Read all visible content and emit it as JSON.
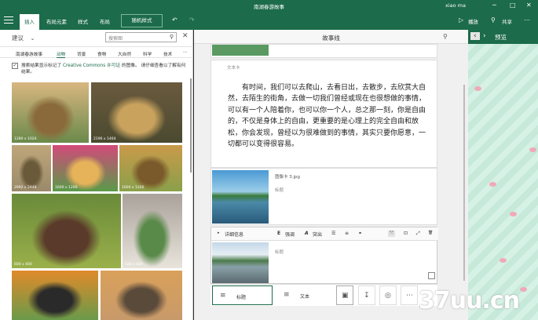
{
  "window": {
    "title": "南湖春游故事",
    "user": "xiao ma",
    "minimize": "─",
    "maximize": "□",
    "close": "✕"
  },
  "ribbon": {
    "tabs": [
      "插入",
      "布局元素",
      "样式",
      "布局"
    ],
    "layout_button": "随机样式",
    "play": "播放",
    "share": "共享",
    "undo_icon": "↶",
    "redo_icon": "↷",
    "play_icon": "▷",
    "share_icon": "⚲",
    "more_icon": "⋯"
  },
  "left_panel": {
    "suggest": "建议",
    "suggest_caret": "⌄",
    "search_placeholder": "搜索图",
    "search_icon": "⚲",
    "close_icon": "✕",
    "categories": [
      "南湖春游故事",
      "动物",
      "背景",
      "食物",
      "大自然",
      "科学",
      "技术",
      "⋯"
    ],
    "cc_check": "✓",
    "cc_notice_pre": "搜索结果显示标记了 ",
    "cc_link": "Creative Commons 许可证",
    "cc_notice_post": " 的图像。 请仔细查看以了解有何结果。",
    "photos": [
      {
        "dim": "1280 x 1024",
        "colors": [
          "#d9b681",
          "#8a6a3a",
          "#6a8a4a"
        ]
      },
      {
        "dim": "2196 x 1464",
        "colors": [
          "#6b5a3e",
          "#c9a35e",
          "#4a4a30"
        ]
      },
      {
        "dim": "2992 x 2448",
        "colors": [
          "#bfa67a",
          "#6a5a3a",
          "#9a8a6a"
        ]
      },
      {
        "dim": "1600 x 1200",
        "colors": [
          "#d24a7a",
          "#e6b25a",
          "#5a9a4a"
        ]
      },
      {
        "dim": "1600 x 1200",
        "colors": [
          "#c99a4a",
          "#7a5a2a",
          "#8aa04a"
        ]
      },
      {
        "dim": "600 x 400",
        "colors": [
          "#6a8a3a",
          "#5a3a2a",
          "#9ab04a"
        ]
      },
      {
        "dim": "528 x 640",
        "colors": [
          "#aaa29a",
          "#5a8a4a",
          "#e8e4dc"
        ]
      },
      {
        "dim": "",
        "colors": [
          "#e08a2a",
          "#2a2a2a",
          "#6a9a4a"
        ]
      },
      {
        "dim": "",
        "colors": [
          "#d9a05a",
          "#5a4a3a",
          "#c89a6a"
        ]
      }
    ]
  },
  "storyline": {
    "title": "故事线",
    "search_icon": "⚲",
    "text_card": {
      "label": "文本卡",
      "body": "有时间，我们可以去爬山，去看日出，去散步，去欣赏大自然，去陌生的街角，去做一切我们曾经或现在也很想做的事情，可以有一个人陪着你，也可以你一个人，总之那一刻，你是自由的，不仅是身体上的自由，更重要的是心理上的完全自由和放松，你会发现，曾经以为很难做到的事情，其实只要你愿意，一切都可以变得很容易。"
    },
    "image_card": {
      "name": "图像卡 3.jpg",
      "caption": "标题"
    },
    "detail_card": {
      "details": "详细信息",
      "emphasis": "强调",
      "highlight": "突出",
      "caption": "标题",
      "toggle_icon": "▸",
      "emphasis_icon": "E",
      "highlight_icon": "A",
      "list_icon": "☰",
      "olist_icon": "≡",
      "link_icon": "⚭",
      "fit_icon": "⤧",
      "crop_icon": "⊡",
      "expand_icon": "⤢",
      "delete_icon": "🗑"
    },
    "bottom": {
      "title_btn": "标题",
      "text_btn": "文本",
      "title_icon": "≡",
      "text_icon": "≡",
      "image_icon": "▣",
      "text_down_icon": "↧",
      "camera_icon": "◎",
      "more_icon": "⋯"
    }
  },
  "preview": {
    "title": "预览",
    "left_icon": "‹",
    "right_icon": "›"
  },
  "watermark": "37uu.cn"
}
